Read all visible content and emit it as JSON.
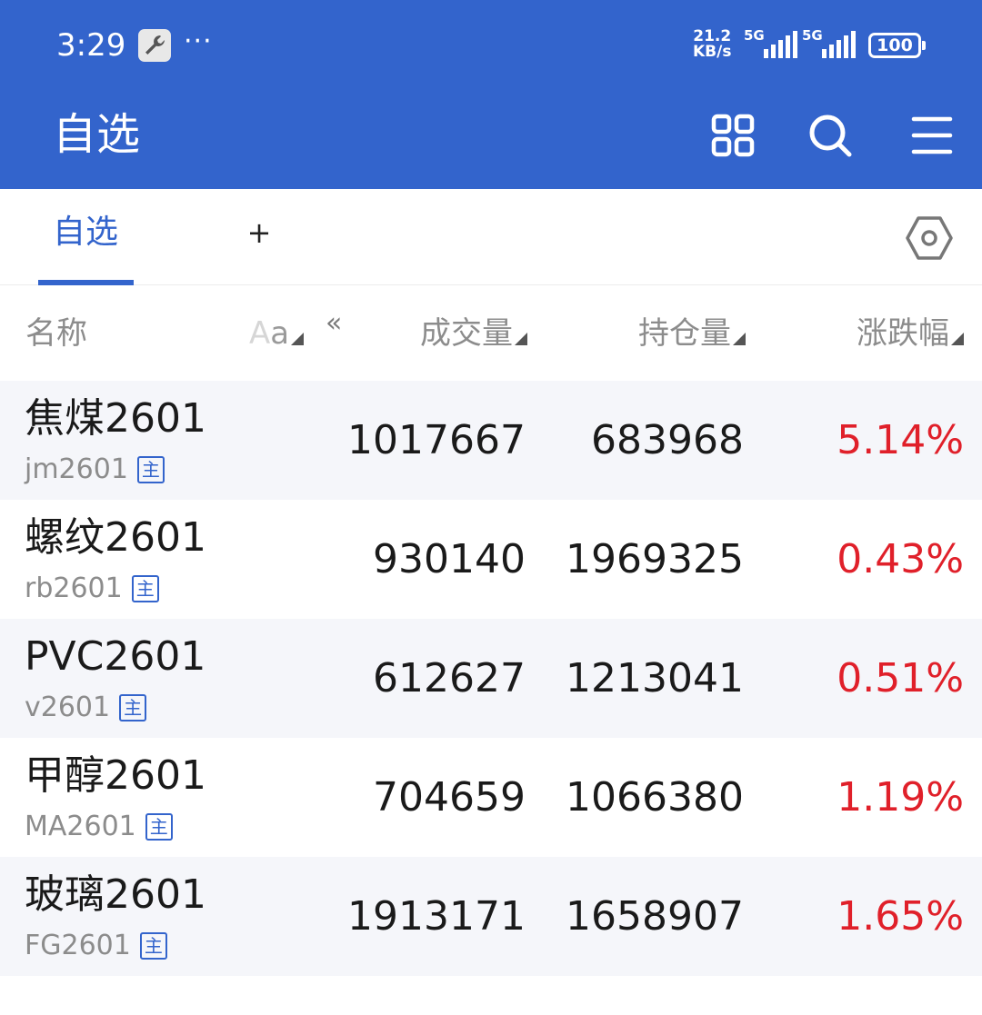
{
  "status_bar": {
    "time": "3:29",
    "more": "···",
    "net_speed_value": "21.2",
    "net_speed_unit": "KB/s",
    "sim1_label": "5G",
    "sim2_label": "5G",
    "battery": "100"
  },
  "header": {
    "title": "自选",
    "icons": [
      "grid-icon",
      "search-icon",
      "menu-icon"
    ]
  },
  "tabs": {
    "active_label": "自选",
    "add_label": "+"
  },
  "columns": {
    "name": "名称",
    "aa_big": "A",
    "aa_small": "a",
    "collapse": "«",
    "volume": "成交量",
    "open_interest": "持仓量",
    "change": "涨跌幅"
  },
  "main_badge": "主",
  "colors": {
    "brand": "#3364cc",
    "rise": "#e0202a",
    "row_alt": "#f5f6fa"
  },
  "rows": [
    {
      "name": "焦煤2601",
      "code": "jm2601",
      "volume": "1017667",
      "open_interest": "683968",
      "change": "5.14%"
    },
    {
      "name": "螺纹2601",
      "code": "rb2601",
      "volume": "930140",
      "open_interest": "1969325",
      "change": "0.43%"
    },
    {
      "name": "PVC2601",
      "code": "v2601",
      "volume": "612627",
      "open_interest": "1213041",
      "change": "0.51%"
    },
    {
      "name": "甲醇2601",
      "code": "MA2601",
      "volume": "704659",
      "open_interest": "1066380",
      "change": "1.19%"
    },
    {
      "name": "玻璃2601",
      "code": "FG2601",
      "volume": "1913171",
      "open_interest": "1658907",
      "change": "1.65%"
    }
  ]
}
